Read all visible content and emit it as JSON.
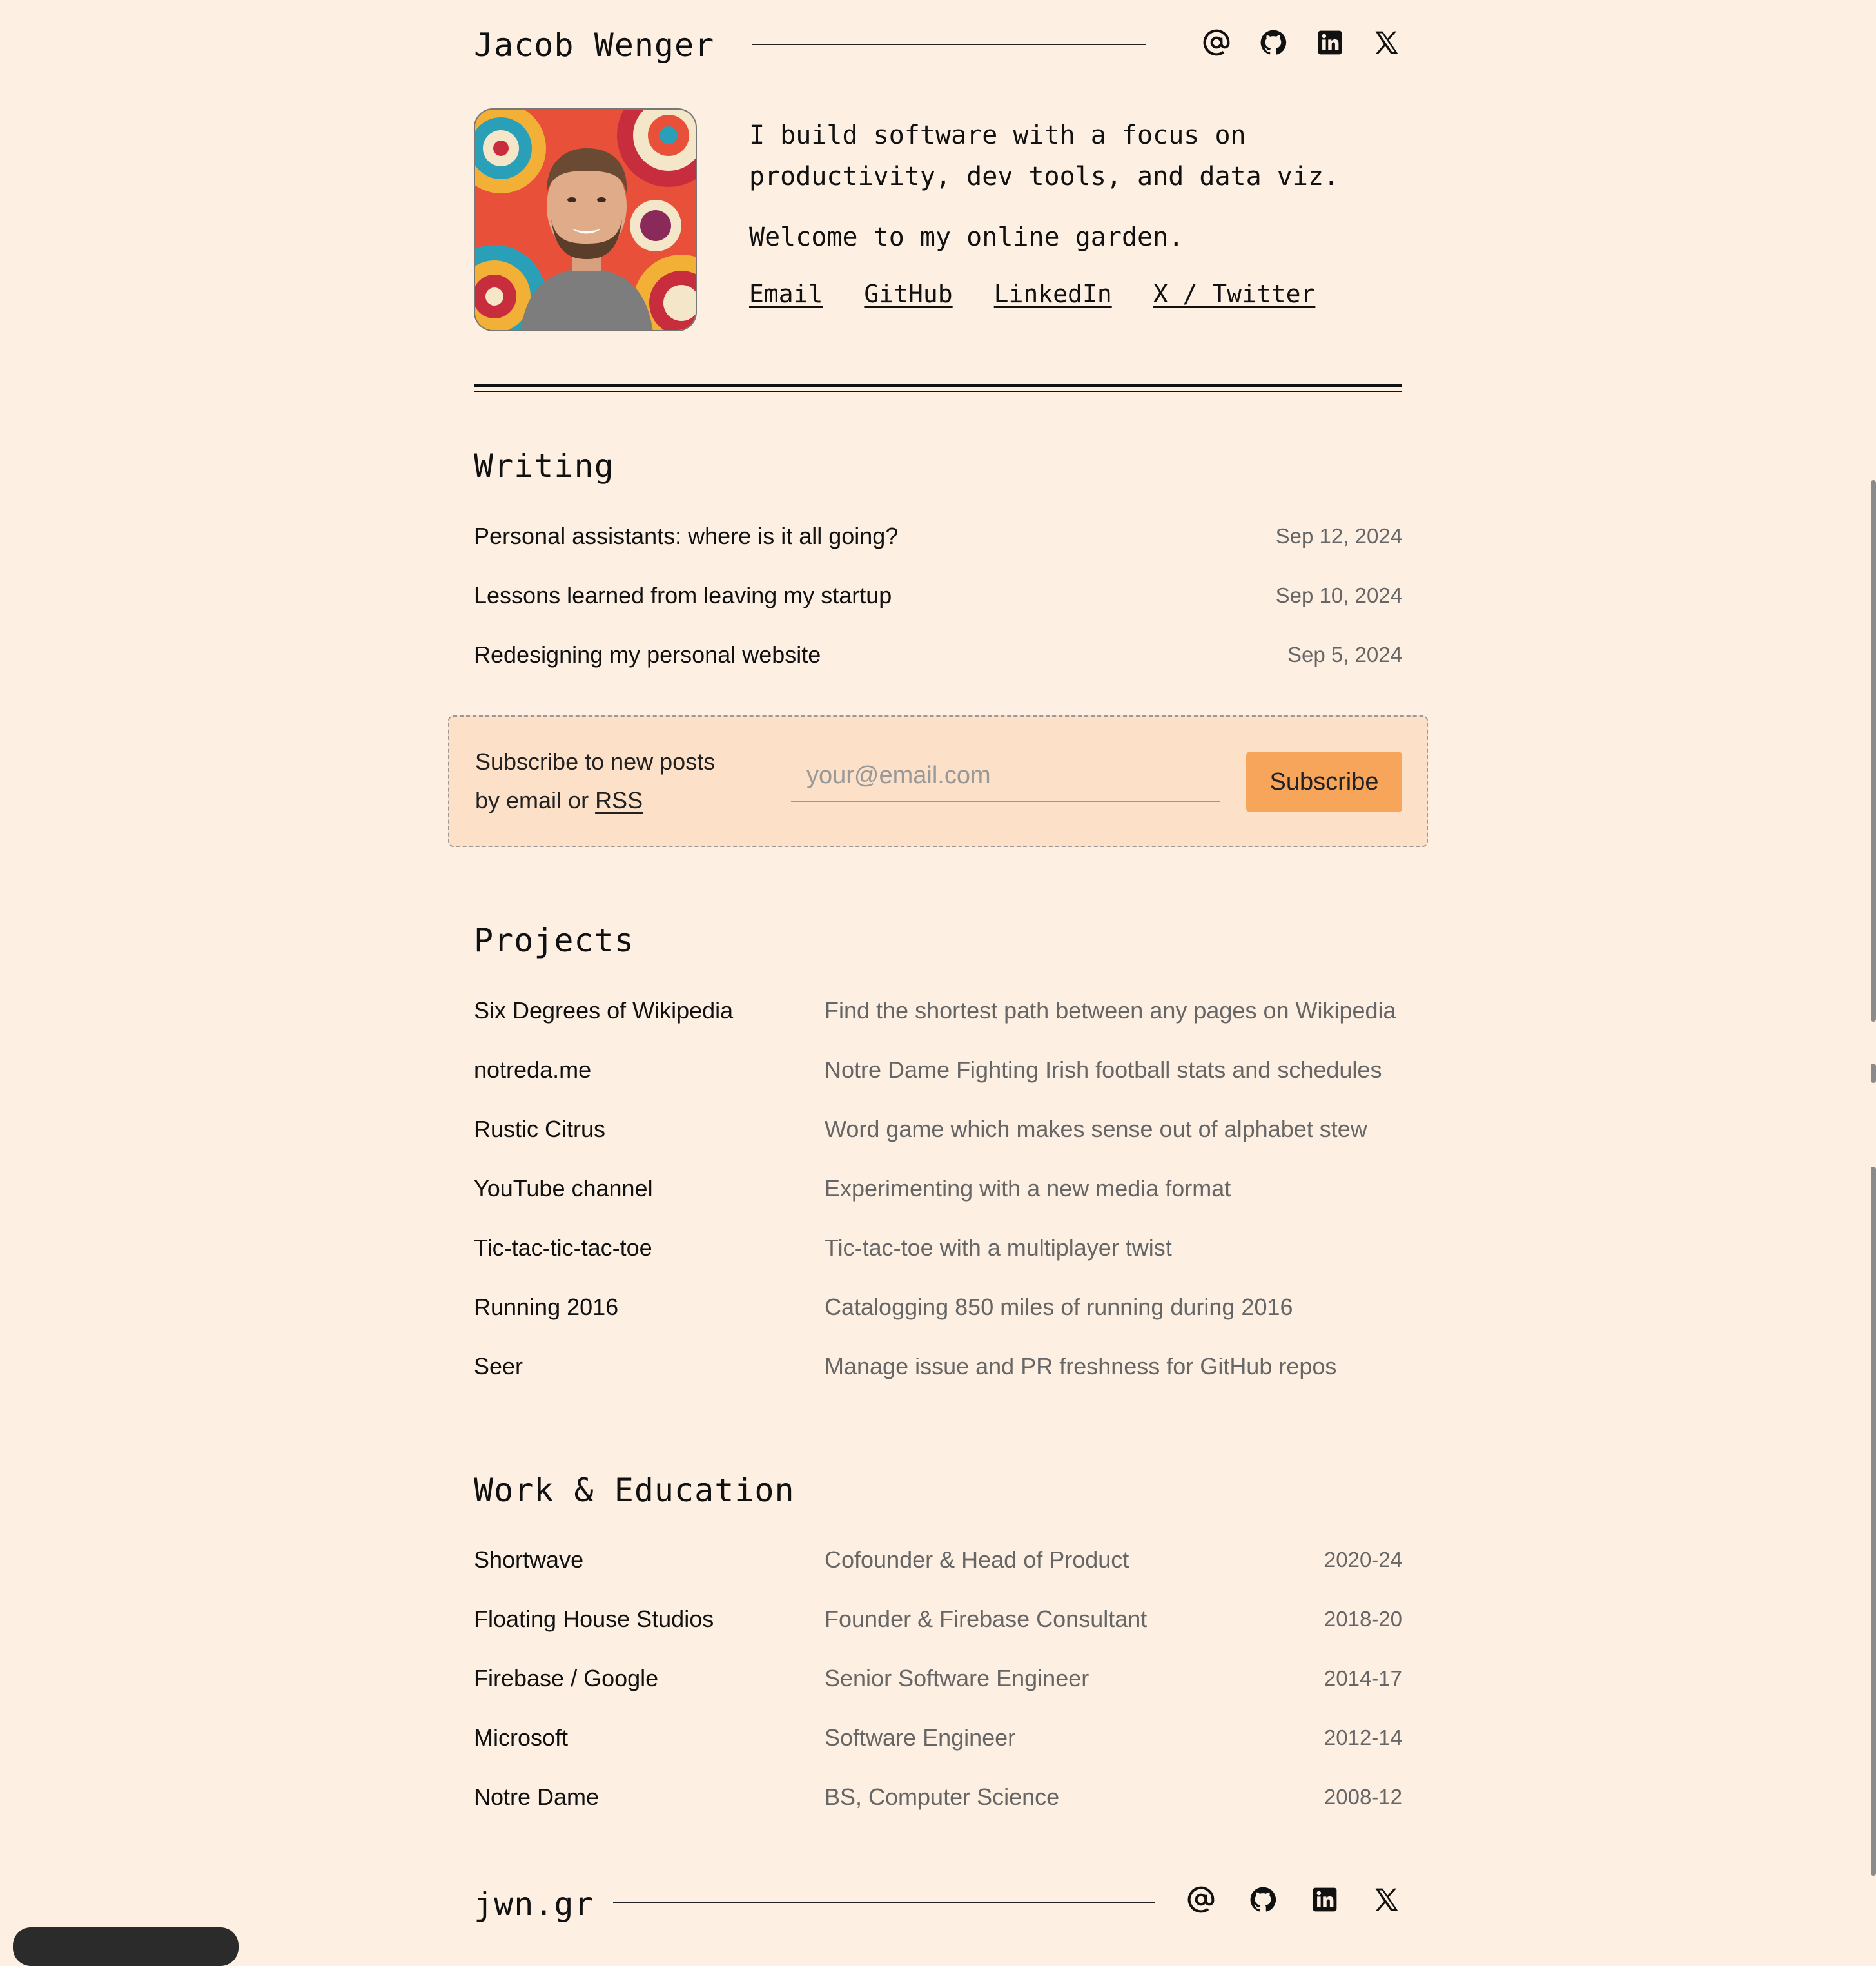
{
  "header": {
    "title": "Jacob Wenger",
    "icons": [
      "at-icon",
      "github-icon",
      "linkedin-icon",
      "x-icon"
    ]
  },
  "intro": {
    "line1": "I build software with a focus on productivity, dev tools, and data viz.",
    "line2": "Welcome to my online garden.",
    "links": [
      "Email",
      "GitHub",
      "LinkedIn",
      "X / Twitter"
    ]
  },
  "writing": {
    "heading": "Writing",
    "posts": [
      {
        "title": "Personal assistants: where is it all going?",
        "date": "Sep 12, 2024"
      },
      {
        "title": "Lessons learned from leaving my startup",
        "date": "Sep 10, 2024"
      },
      {
        "title": "Redesigning my personal website",
        "date": "Sep 5, 2024"
      }
    ]
  },
  "subscribe": {
    "text_before": "Subscribe to new posts by email or ",
    "rss_label": "RSS",
    "placeholder": "your@email.com",
    "button_label": "Subscribe"
  },
  "projects": {
    "heading": "Projects",
    "items": [
      {
        "name": "Six Degrees of Wikipedia",
        "desc": "Find the shortest path between any pages on Wikipedia"
      },
      {
        "name": "notreda.me",
        "desc": "Notre Dame Fighting Irish football stats and schedules"
      },
      {
        "name": "Rustic Citrus",
        "desc": "Word game which makes sense out of alphabet stew"
      },
      {
        "name": "YouTube channel",
        "desc": "Experimenting with a new media format"
      },
      {
        "name": "Tic-tac-tic-tac-toe",
        "desc": "Tic-tac-toe with a multiplayer twist"
      },
      {
        "name": "Running 2016",
        "desc": "Catalogging 850 miles of running during 2016"
      },
      {
        "name": "Seer",
        "desc": "Manage issue and PR freshness for GitHub repos"
      }
    ]
  },
  "work": {
    "heading": "Work & Education",
    "items": [
      {
        "org": "Shortwave",
        "role": "Cofounder & Head of Product",
        "years": "2020-24"
      },
      {
        "org": "Floating House Studios",
        "role": "Founder & Firebase Consultant",
        "years": "2018-20"
      },
      {
        "org": "Firebase / Google",
        "role": "Senior Software Engineer",
        "years": "2014-17"
      },
      {
        "org": "Microsoft",
        "role": "Software Engineer",
        "years": "2012-14"
      },
      {
        "org": "Notre Dame",
        "role": "BS, Computer Science",
        "years": "2008-12"
      }
    ]
  },
  "footer": {
    "title": "jwn.gr"
  },
  "colors": {
    "background": "#fdefe2",
    "subscribe_bg": "#fde0c8",
    "accent_button": "#f8a55c",
    "muted_text": "#666666"
  }
}
